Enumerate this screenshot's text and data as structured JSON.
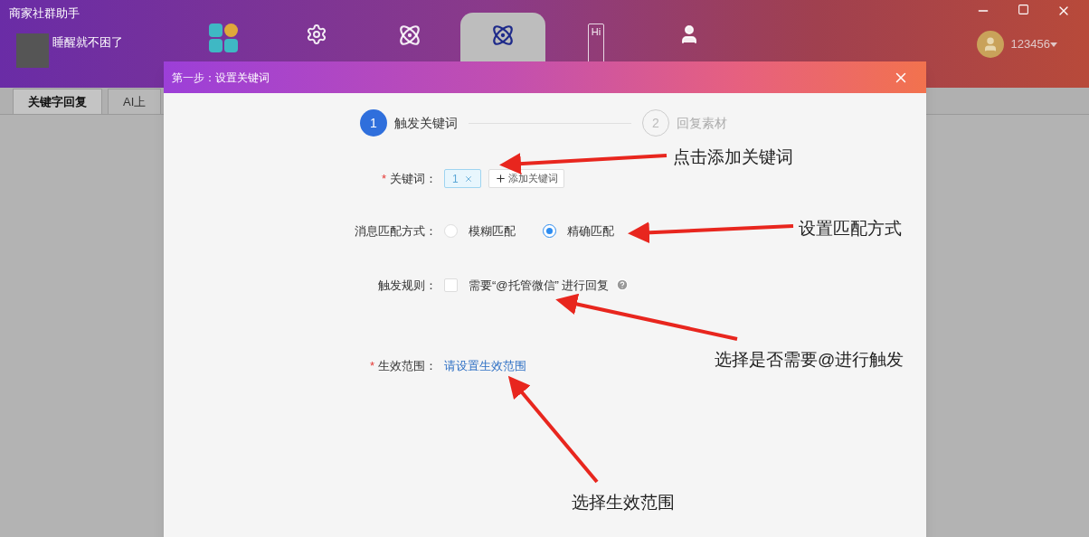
{
  "window": {
    "title": "商家社群助手"
  },
  "profile": {
    "name": "睡醒就不困了"
  },
  "nav": [
    {
      "kind": "grid",
      "selected": false
    },
    {
      "kind": "gear",
      "selected": false
    },
    {
      "kind": "atom",
      "selected": false
    },
    {
      "kind": "atom",
      "selected": true
    },
    {
      "kind": "hi",
      "text": "Hi",
      "selected": false
    },
    {
      "kind": "person",
      "selected": false
    }
  ],
  "account": {
    "name": "123456"
  },
  "tabs": [
    {
      "label": "关键字回复",
      "selected": true
    },
    {
      "label": "AI上",
      "selected": false
    }
  ],
  "dialog": {
    "title": "第一步：设置关键词",
    "steps": [
      {
        "number": "1",
        "label": "触发关键词",
        "selected": true
      },
      {
        "number": "2",
        "label": "回复素材",
        "selected": false
      }
    ],
    "keyword": {
      "label": "关键词：",
      "required_mark": "*",
      "tags": [
        "1"
      ],
      "add_button": "添加关键词"
    },
    "match": {
      "label": "消息匹配方式：",
      "options": [
        {
          "label": "模糊匹配",
          "selected": false
        },
        {
          "label": "精确匹配",
          "selected": true
        }
      ]
    },
    "rule": {
      "label": "触发规则：",
      "checked": false,
      "text": "需要“@托管微信” 进行回复"
    },
    "scope": {
      "label": "生效范围：",
      "required_mark": "*",
      "link": "请设置生效范围"
    }
  },
  "annotations": [
    "点击添加关键词",
    "设置匹配方式",
    "选择是否需要@进行触发",
    "选择生效范围"
  ]
}
